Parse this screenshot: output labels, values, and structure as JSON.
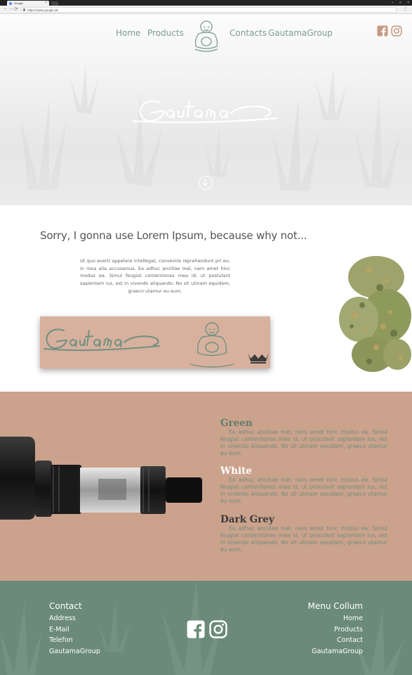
{
  "browser": {
    "tab_title": "Google",
    "url": "https://www.google.dk",
    "tab_close": "×",
    "window_controls": [
      "–",
      "□",
      "×"
    ],
    "nav_glyphs": [
      "←",
      "→",
      "⟳"
    ],
    "menu": "⋮"
  },
  "nav": {
    "items": [
      {
        "label": "Home"
      },
      {
        "label": "Products"
      },
      {
        "label": "Contacts"
      },
      {
        "label": "GautamaGroup"
      }
    ],
    "social_icons": [
      "facebook-icon",
      "instagram-icon"
    ]
  },
  "hero": {
    "brand": "Gautama",
    "scroll_icon": "arrow-down-circle-icon"
  },
  "intro": {
    "heading": "Sorry, I gonna use Lorem Ipsum, because why not...",
    "body": "Ut quo everti appetere intellegat, convenire reprehendunt pri eu, in mea alia accusamus. Ea adhuc ancillae mel, nam amet hinc modus ea. Simul feugiat contentiones mea id, ut postulant sapientem ius, est in vivendo aliquando. No sit utinam equidem, graeco utamur eu eum.",
    "banner_brand": "Gautama"
  },
  "products": [
    {
      "name": "Green",
      "color": "#5f7f6e",
      "text": "Ea adhuc ancillae mel, nam amet hinc modus ea. Simul feugiat contentiones mea id, ut postulant sapientem ius, est in vivendo aliquando. No sit utinam equidem, graeco utamur eu eum."
    },
    {
      "name": "White",
      "color": "#ffffff",
      "text": "Ea adhuc ancillae mel, nam amet hinc modus ea. Simul feugiat contentiones mea id, ut postulant sapientem ius, est in vivendo aliquando. No sit utinam equidem, graeco utamur eu eum."
    },
    {
      "name": "Dark Grey",
      "color": "#3a3a3a",
      "text": "Ea adhuc ancillae mel, nam amet hinc modus ea. Simul feugiat contentiones mea id, ut postulant sapientem ius, est in vivendo aliquando. No sit utinam equidem, graeco utamur eu eum."
    }
  ],
  "footer": {
    "contact": {
      "title": "Contact",
      "links": [
        "Address",
        "E-Mail",
        "Telefon",
        "GautamaGroup"
      ]
    },
    "menu": {
      "title": "Menu Collum",
      "links": [
        "Home",
        "Products",
        "Contact",
        "GautamaGroup"
      ]
    },
    "social_icons": [
      "facebook-icon",
      "instagram-icon"
    ]
  },
  "colors": {
    "accent_green": "#7b9c8d",
    "product_bg": "#cba28c",
    "banner_bg": "#d7b09e",
    "footer_bg": "#6b8a7a"
  }
}
